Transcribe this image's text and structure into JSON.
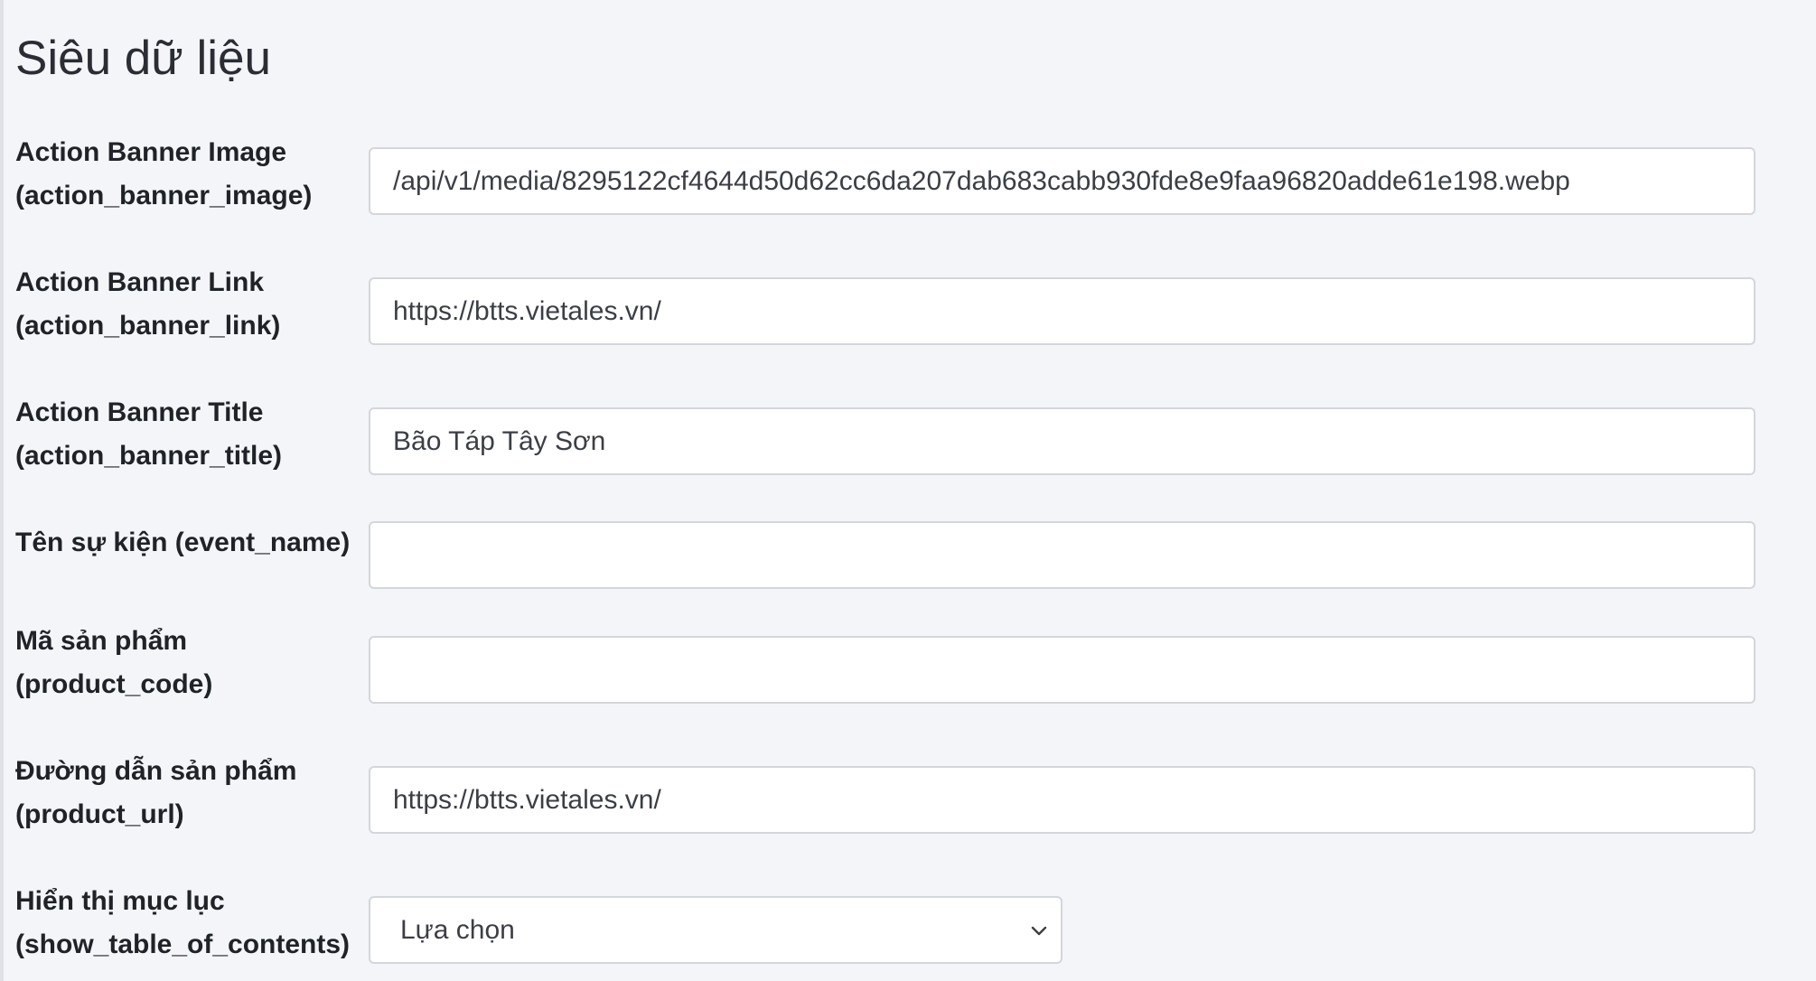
{
  "page": {
    "title": "Siêu dữ liệu"
  },
  "fields": [
    {
      "label_line1": "Action Banner Image",
      "label_line2": "(action_banner_image)",
      "value": "/api/v1/media/8295122cf4644d50d62cc6da207dab683cabb930fde8e9faa96820adde61e198.webp"
    },
    {
      "label_line1": "Action Banner Link",
      "label_line2": "(action_banner_link)",
      "value": "https://btts.vietales.vn/"
    },
    {
      "label_line1": "Action Banner Title",
      "label_line2": "(action_banner_title)",
      "value": "Bão Táp Tây Sơn"
    },
    {
      "label_line1": "Tên sự kiện (event_name)",
      "label_line2": "",
      "value": ""
    },
    {
      "label_line1": "Mã sản phẩm",
      "label_line2": "(product_code)",
      "value": ""
    },
    {
      "label_line1": "Đường dẫn sản phẩm",
      "label_line2": "(product_url)",
      "value": "https://btts.vietales.vn/"
    },
    {
      "label_line1": "Hiển thị mục lục",
      "label_line2": "(show_table_of_contents)",
      "value": "Lựa chọn",
      "icon": "chevron-down-icon"
    }
  ]
}
